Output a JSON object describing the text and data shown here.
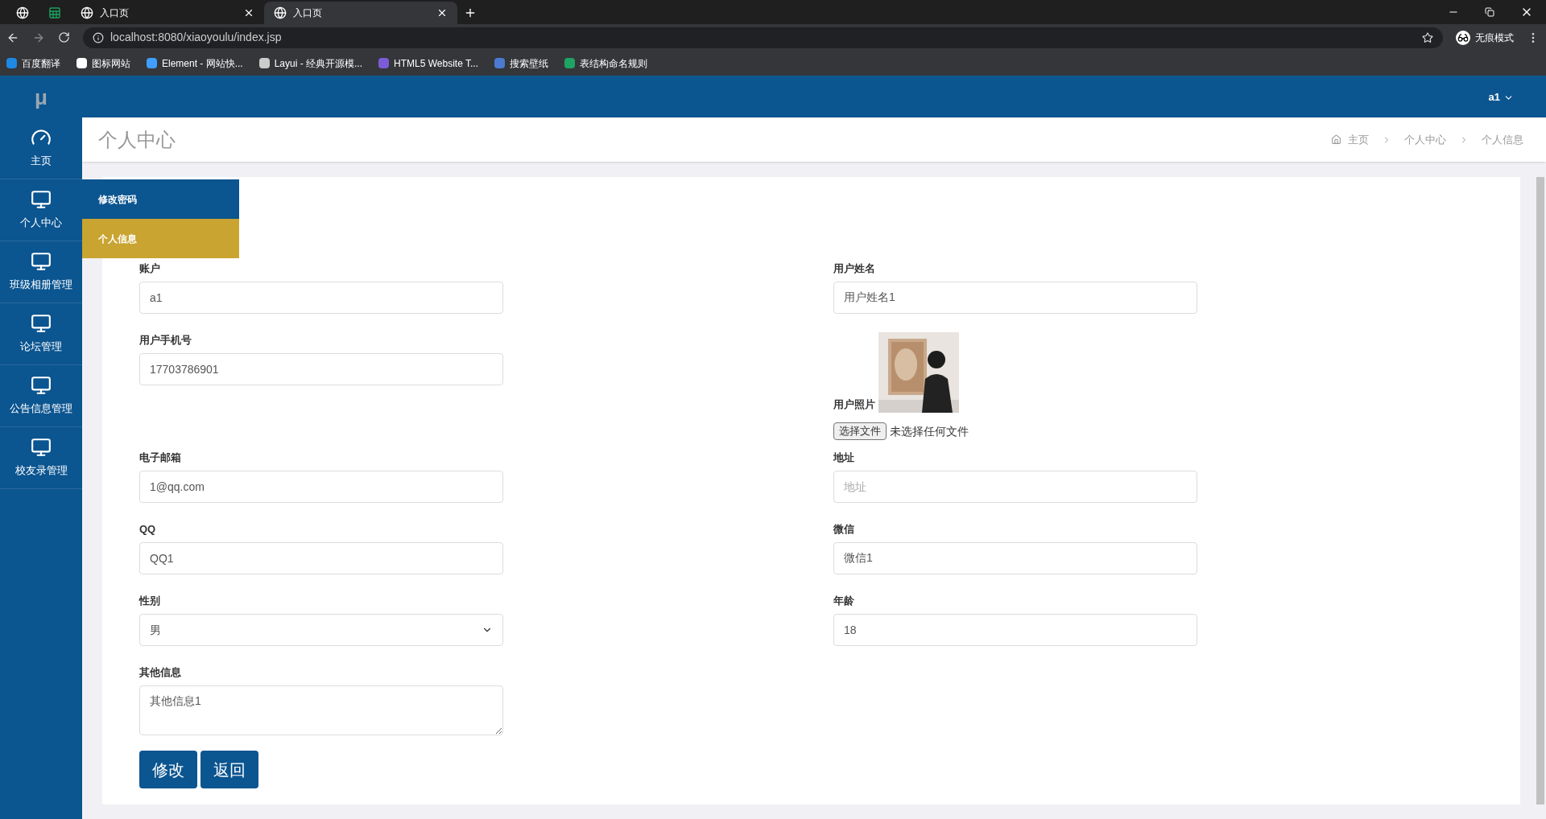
{
  "browser": {
    "tabs": [
      {
        "kind": "globe",
        "selected": false
      },
      {
        "kind": "sheet",
        "selected": false
      },
      {
        "kind": "globe",
        "label": "入口页",
        "selected": false
      },
      {
        "kind": "globe",
        "label": "入口页",
        "selected": true
      }
    ],
    "url": "localhost:8080/xiaoyoulu/index.jsp",
    "incognito": "无痕模式",
    "bookmarks": [
      {
        "label": "百度翻译",
        "color": "#1e88e5"
      },
      {
        "label": "图标网站",
        "color": "#ffffff"
      },
      {
        "label": "Element - 网站快...",
        "color": "#409eff"
      },
      {
        "label": "Layui - 经典开源模...",
        "color": "#cccccc"
      },
      {
        "label": "HTML5 Website T...",
        "color": "#7b5cd6"
      },
      {
        "label": "搜索壁纸",
        "color": "#4a7bd0"
      },
      {
        "label": "表结构命名规则",
        "color": "#1ea362"
      }
    ]
  },
  "header": {
    "logo": "μ",
    "user": "a1"
  },
  "sidebar": {
    "items": [
      {
        "kind": "dashboard",
        "label": "主页"
      },
      {
        "kind": "monitor",
        "label": "个人中心",
        "children": [
          {
            "label": "修改密码",
            "selected": false
          },
          {
            "label": "个人信息",
            "selected": true
          }
        ]
      },
      {
        "kind": "monitor",
        "label": "班级相册管理"
      },
      {
        "kind": "monitor",
        "label": "论坛管理"
      },
      {
        "kind": "monitor",
        "label": "公告信息管理"
      },
      {
        "kind": "monitor",
        "label": "校友录管理"
      }
    ]
  },
  "page_title": "个人中心",
  "breadcrumb": [
    "主页",
    "个人中心",
    "个人信息"
  ],
  "form": {
    "left": [
      {
        "kind": "text",
        "label": "账户",
        "value": "a1"
      },
      {
        "kind": "text",
        "label": "用户手机号",
        "value": "17703786901"
      },
      {
        "kind": "text",
        "label": "电子邮箱",
        "value": "1@qq.com"
      },
      {
        "kind": "text",
        "label": "QQ",
        "value": "QQ1"
      },
      {
        "kind": "select",
        "label": "性别",
        "value": "男"
      },
      {
        "kind": "textarea",
        "label": "其他信息",
        "value": "其他信息1"
      }
    ],
    "right": [
      {
        "kind": "text",
        "label": "用户姓名",
        "value": "用户姓名1"
      },
      {
        "label": "用户照片",
        "button": "选择文件",
        "status": "未选择任何文件"
      },
      {
        "kind": "text",
        "label": "地址",
        "placeholder": "地址"
      },
      {
        "kind": "text",
        "label": "微信",
        "value": "微信1"
      },
      {
        "kind": "text",
        "label": "年龄",
        "value": "18"
      }
    ],
    "buttons": [
      "修改",
      "返回"
    ]
  }
}
